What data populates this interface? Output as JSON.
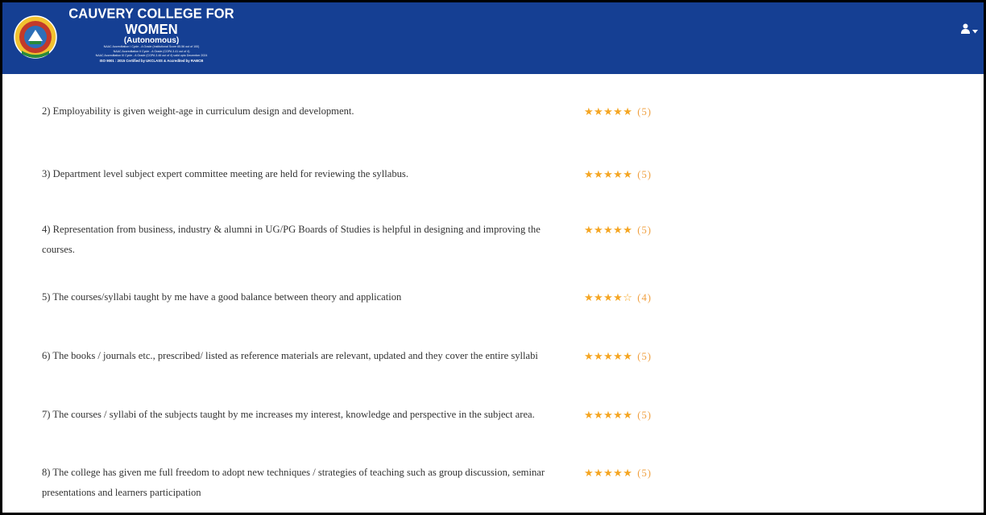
{
  "header": {
    "college_name": "CAUVERY COLLEGE FOR WOMEN",
    "subtitle": "(Autonomous)",
    "accreditation_lines": [
      "NAAC Accreditation I Cycle - A Grade (Institutional Score 85.56 out of 100)",
      "NAAC Accreditation II Cycle - A Grade (CGPA 3.41 out of 4)",
      "NAAC Accreditation III Cycle - A Grade (CGPA 3.46 out of 4) valid upto December 2024"
    ],
    "iso_line": "ISO 9001 : 2015 Certified by UKCLASS & Accredited by RABCB",
    "user_icon": "user-icon",
    "caret_icon": "caret-down-icon",
    "colors": {
      "bar": "#153f93",
      "star": "#f5a623"
    }
  },
  "questions": [
    {
      "text": "2) Employability is given weight-age in curriculum design and development.",
      "stars": "★★★★★",
      "rating": 5,
      "score_label": "(5)"
    },
    {
      "text": "3) Department level subject expert committee meeting are held for reviewing the syllabus.",
      "stars": "★★★★★",
      "rating": 5,
      "score_label": "(5)"
    },
    {
      "text": "4) Representation from business, industry & alumni in UG/PG Boards of Studies is helpful in designing and improving the courses.",
      "stars": "★★★★★",
      "rating": 5,
      "score_label": "(5)"
    },
    {
      "text": "5) The courses/syllabi taught by me have a good balance between theory and application",
      "stars": "★★★★☆",
      "rating": 4,
      "score_label": "(4)"
    },
    {
      "text": "6) The books / journals etc., prescribed/ listed as reference materials are relevant, updated and they cover the entire syllabi",
      "stars": "★★★★★",
      "rating": 5,
      "score_label": "(5)"
    },
    {
      "text": "7) The courses / syllabi of the subjects taught by me increases my interest, knowledge and perspective in the subject area.",
      "stars": "★★★★★",
      "rating": 5,
      "score_label": "(5)"
    },
    {
      "text": "8) The college has given me full freedom to adopt new techniques / strategies of teaching such as group discussion, seminar presentations and learners participation",
      "stars": "★★★★★",
      "rating": 5,
      "score_label": "(5)"
    }
  ]
}
